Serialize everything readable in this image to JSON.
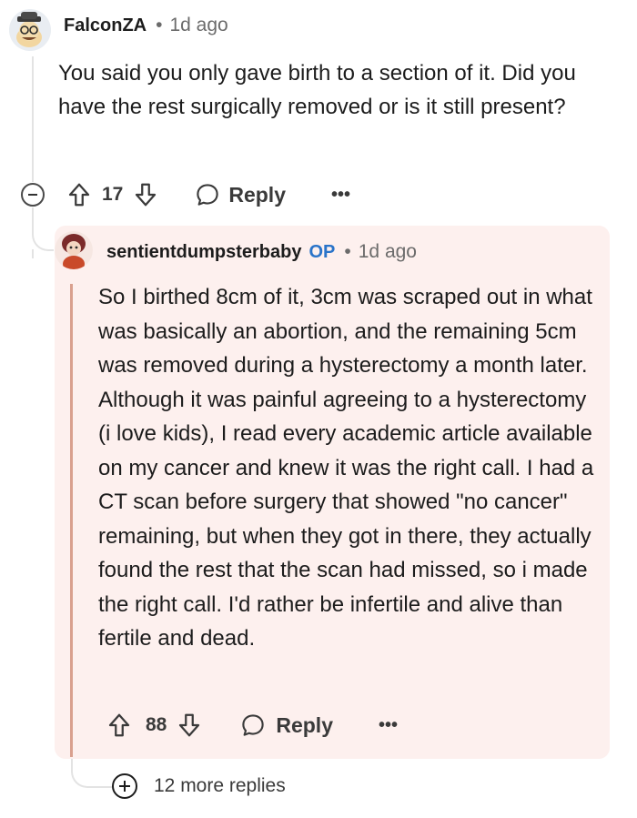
{
  "comment": {
    "username": "FalconZA",
    "time": "1d ago",
    "body": "You said you only gave birth to a section of it. Did you have the rest surgically removed or is it still present?",
    "upvotes": "17",
    "reply_label": "Reply",
    "more_label": "•••"
  },
  "reply": {
    "username": "sentientdumpsterbaby",
    "op_badge": "OP",
    "time": "1d ago",
    "body": "So I birthed 8cm of it, 3cm was scraped out in what was basically an abortion, and the remaining 5cm was removed during a hysterectomy a month later. Although it was painful agreeing to a hysterectomy (i love kids), I read every academic article available on my cancer and knew it was the right call. I had a CT scan before surgery that showed \"no cancer\" remaining, but when they got in there, they actually found the rest that the scan had missed, so i made the right call. I'd rather be infertile and alive than fertile and dead.",
    "upvotes": "88",
    "reply_label": "Reply",
    "more_label": "•••"
  },
  "more_replies": "12 more replies",
  "colors": {
    "op_badge": "#2a74c9",
    "highlight_bg": "#fdf0ee",
    "op_bar": "#d9a08e"
  },
  "icons": [
    "collapse-icon",
    "upvote-icon",
    "downvote-icon",
    "reply-bubble-icon",
    "more-icon",
    "expand-plus-icon"
  ]
}
